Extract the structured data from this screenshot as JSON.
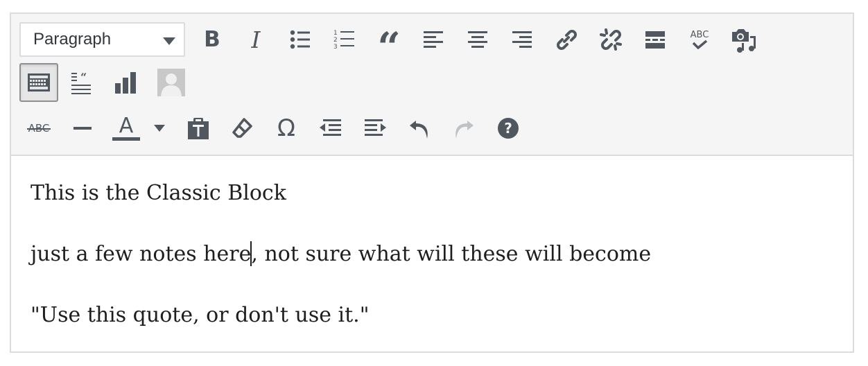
{
  "toolbar": {
    "format_select": {
      "value": "Paragraph"
    },
    "row1": [
      {
        "name": "bold-button",
        "icon": "bold-icon"
      },
      {
        "name": "italic-button",
        "icon": "italic-icon"
      },
      {
        "name": "bulleted-list-button",
        "icon": "bulleted-list-icon"
      },
      {
        "name": "numbered-list-button",
        "icon": "numbered-list-icon"
      },
      {
        "name": "blockquote-button",
        "icon": "quote-icon"
      },
      {
        "name": "align-left-button",
        "icon": "align-left-icon"
      },
      {
        "name": "align-center-button",
        "icon": "align-center-icon"
      },
      {
        "name": "align-right-button",
        "icon": "align-right-icon"
      },
      {
        "name": "insert-link-button",
        "icon": "link-icon"
      },
      {
        "name": "remove-link-button",
        "icon": "unlink-icon"
      },
      {
        "name": "read-more-button",
        "icon": "read-more-icon"
      },
      {
        "name": "spellcheck-button",
        "icon": "spellcheck-icon"
      },
      {
        "name": "add-media-button",
        "icon": "media-icon"
      }
    ],
    "row2": [
      {
        "name": "toolbar-toggle-button",
        "icon": "keyboard-icon",
        "active": true
      },
      {
        "name": "pullquote-button",
        "icon": "pullquote-icon"
      },
      {
        "name": "chart-button",
        "icon": "bar-chart-icon"
      },
      {
        "name": "avatar-button",
        "icon": "avatar-icon"
      }
    ],
    "row3": [
      {
        "name": "strikethrough-button",
        "icon": "strikethrough-icon"
      },
      {
        "name": "horizontal-line-button",
        "icon": "horizontal-line-icon"
      },
      {
        "name": "text-color-button",
        "icon": "text-color-icon"
      },
      {
        "name": "text-color-dropdown-button",
        "icon": "chevron-down-icon"
      },
      {
        "name": "paste-as-text-button",
        "icon": "clipboard-icon"
      },
      {
        "name": "clear-formatting-button",
        "icon": "eraser-icon"
      },
      {
        "name": "special-character-button",
        "icon": "omega-icon"
      },
      {
        "name": "decrease-indent-button",
        "icon": "outdent-icon"
      },
      {
        "name": "increase-indent-button",
        "icon": "indent-icon"
      },
      {
        "name": "undo-button",
        "icon": "undo-icon"
      },
      {
        "name": "redo-button",
        "icon": "redo-icon",
        "disabled": true
      },
      {
        "name": "keyboard-shortcuts-button",
        "icon": "help-icon"
      }
    ],
    "glyphs": {
      "bold": "B",
      "italic": "I",
      "quote": "“",
      "spellcheck": "ABC",
      "strikethrough": "ABC",
      "text_color": "A",
      "omega": "Ω",
      "help": "?"
    }
  },
  "content": {
    "paragraphs": [
      "This is the Classic Block",
      {
        "before_cursor": "just a few notes here",
        "after_cursor": ", not sure what will these will become"
      },
      "\"Use this quote, or don't use it.\""
    ]
  },
  "colors": {
    "icon": "#50575e",
    "icon_disabled": "#bfc2c4",
    "toolbar_bg": "#f5f5f5",
    "border": "#dcdcde",
    "text": "#1e1e1e"
  }
}
